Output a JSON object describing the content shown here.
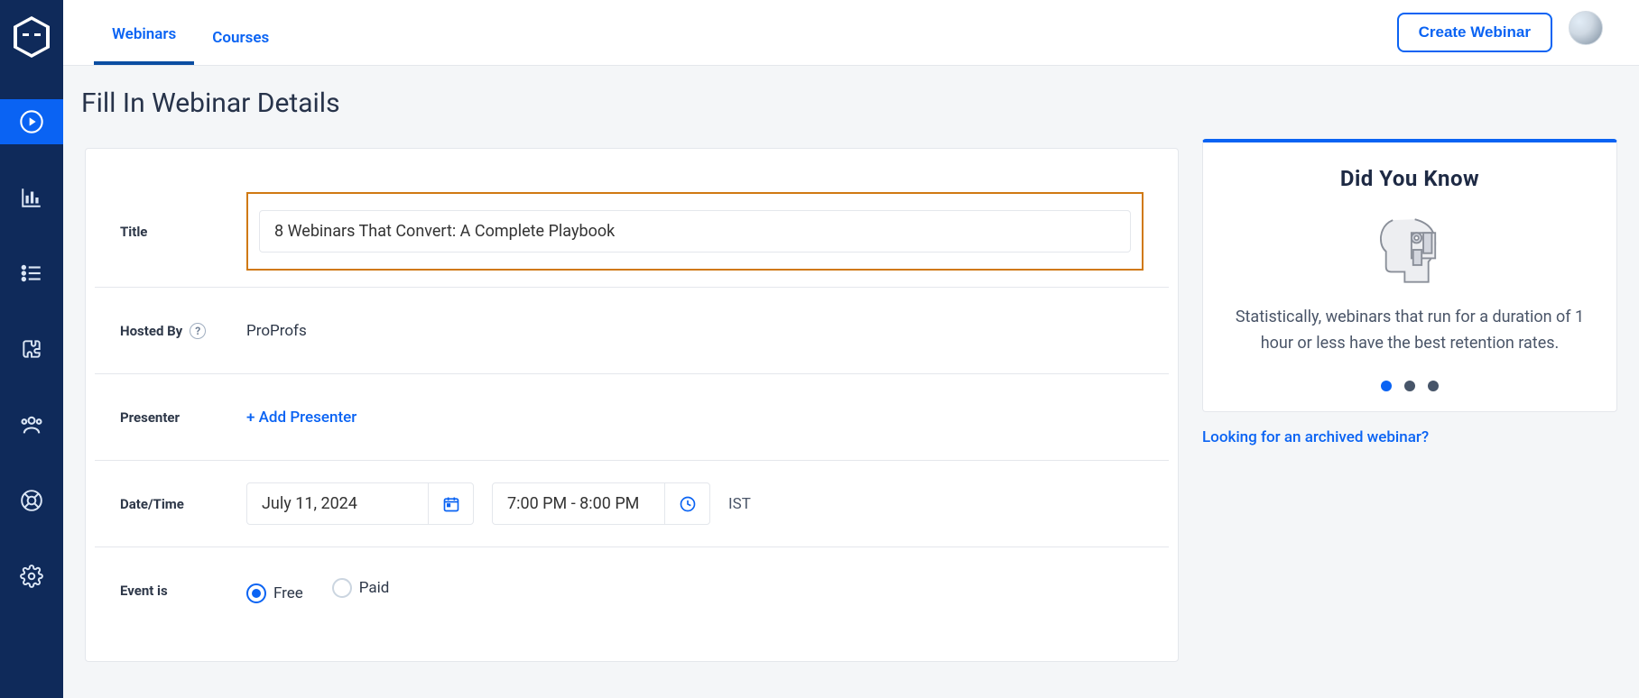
{
  "page_title": "Fill In Webinar Details",
  "tabs": {
    "webinars": "Webinars",
    "courses": "Courses",
    "create_button": "Create Webinar"
  },
  "form": {
    "title_label": "Title",
    "title_value": "8 Webinars That Convert: A Complete Playbook",
    "hosted_by_label": "Hosted By",
    "hosted_by_value": "ProProfs",
    "presenter_label": "Presenter",
    "add_presenter": "+ Add Presenter",
    "datetime_label": "Date/Time",
    "date_value": "July 11, 2024",
    "time_value": "7:00 PM - 8:00 PM",
    "tz": "IST",
    "event_is_label": "Event is",
    "free_label": "Free",
    "paid_label": "Paid"
  },
  "tip": {
    "heading": "Did You Know",
    "body": "Statistically, webinars that run for a duration of 1 hour or less have the best retention rates."
  },
  "archived_link": "Looking for an archived webinar?"
}
